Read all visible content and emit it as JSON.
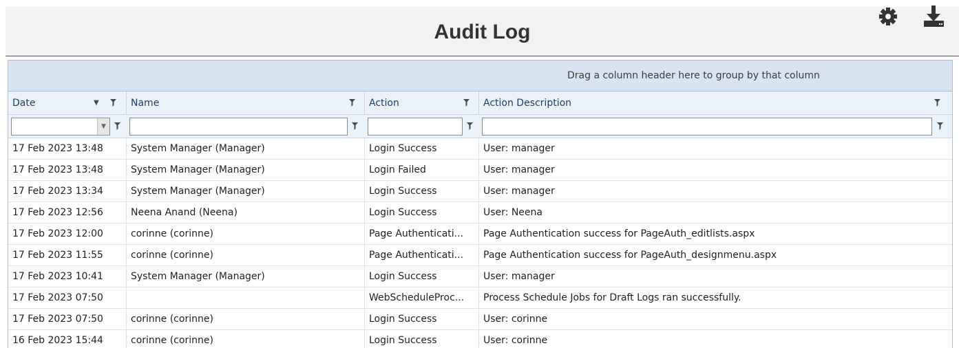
{
  "header": {
    "title": "Audit Log",
    "settings_icon": "gear-icon",
    "download_icon": "download-icon"
  },
  "grid": {
    "group_panel_text": "Drag a column header here to group by that column",
    "columns": [
      {
        "label": "Date",
        "sorted": "descending"
      },
      {
        "label": "Name"
      },
      {
        "label": "Action"
      },
      {
        "label": "Action Description"
      }
    ],
    "rows": [
      {
        "date": "17 Feb 2023 13:48",
        "name": "System Manager (Manager)",
        "action": "Login Success",
        "desc": "User: manager"
      },
      {
        "date": "17 Feb 2023 13:48",
        "name": "System Manager (Manager)",
        "action": "Login Failed",
        "desc": "User: manager"
      },
      {
        "date": "17 Feb 2023 13:34",
        "name": "System Manager (Manager)",
        "action": "Login Success",
        "desc": "User: manager"
      },
      {
        "date": "17 Feb 2023 12:56",
        "name": "Neena Anand (Neena)",
        "action": "Login Success",
        "desc": "User: Neena"
      },
      {
        "date": "17 Feb 2023 12:00",
        "name": "corinne (corinne)",
        "action": "Page Authenticati...",
        "desc": "Page Authentication success for PageAuth_editlists.aspx"
      },
      {
        "date": "17 Feb 2023 11:55",
        "name": "corinne (corinne)",
        "action": "Page Authenticati...",
        "desc": "Page Authentication success for PageAuth_designmenu.aspx"
      },
      {
        "date": "17 Feb 2023 10:41",
        "name": "System Manager (Manager)",
        "action": "Login Success",
        "desc": "User: manager"
      },
      {
        "date": "17 Feb 2023 07:50",
        "name": "",
        "action": "WebScheduleProc...",
        "desc": "Process Schedule Jobs for Draft Logs ran successfully."
      },
      {
        "date": "17 Feb 2023 07:50",
        "name": "corinne (corinne)",
        "action": "Login Success",
        "desc": "User: corinne"
      },
      {
        "date": "16 Feb 2023 15:44",
        "name": "corinne (corinne)",
        "action": "Login Success",
        "desc": "User: corinne"
      }
    ]
  },
  "colors": {
    "group_panel_bg": "#d8e4f2",
    "header_bg": "#ecf2f9",
    "header_text": "#1f3e63",
    "border": "#a9bdd4"
  }
}
